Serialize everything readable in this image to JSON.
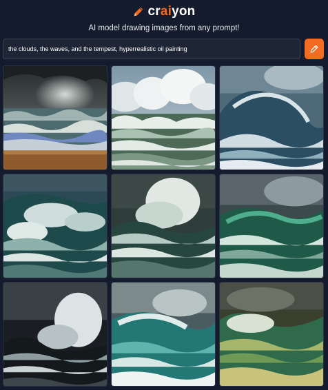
{
  "logo": {
    "prefix": "cr",
    "accent": "ai",
    "suffix": "yon",
    "icon": "pencil-icon"
  },
  "tagline": "AI model drawing images from any prompt!",
  "prompt": {
    "value": "the clouds, the waves, and the tempest, hyperrealistic oil painting",
    "button_icon": "pencil-icon"
  },
  "colors": {
    "background": "#141b2c",
    "accent": "#f26b21"
  },
  "images": [
    {
      "id": "image-1"
    },
    {
      "id": "image-2"
    },
    {
      "id": "image-3"
    },
    {
      "id": "image-4"
    },
    {
      "id": "image-5"
    },
    {
      "id": "image-6"
    },
    {
      "id": "image-7"
    },
    {
      "id": "image-8"
    },
    {
      "id": "image-9"
    }
  ]
}
